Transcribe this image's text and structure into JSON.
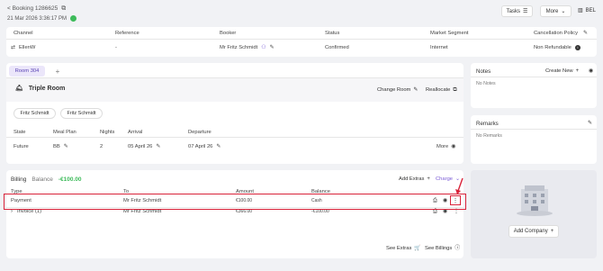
{
  "top": {
    "back_label": "< Booking 1286625",
    "datetime": "21 Mar 2026 3:36:17 PM",
    "tasks_label": "Tasks",
    "more_label": "More",
    "lang_label": "BEL"
  },
  "summary": {
    "headers": [
      "Channel",
      "Reference",
      "Booker",
      "Status",
      "Market Segment",
      "Cancellation Policy"
    ],
    "values": {
      "channel": "EllenW",
      "reference": "-",
      "booker": "Mr Fritz Schmidt",
      "status": "Confirmed",
      "segment": "Internet",
      "policy": "Non Refundable"
    }
  },
  "room": {
    "tab_label": "Room 304",
    "add_tab": "+",
    "room_type": "Triple Room",
    "change_room": "Change Room",
    "reallocate": "Reallocate",
    "guests": [
      "Fritz Schmidt",
      "Fritz Schmidt"
    ],
    "headers": [
      "State",
      "Meal Plan",
      "Nights",
      "Arrival",
      "Departure"
    ],
    "row": {
      "state": "Future",
      "meal_plan": "BB",
      "nights": "2",
      "arrival": "05 April 26",
      "departure": "07 April 26"
    },
    "more_label": "More"
  },
  "notes": {
    "title": "Notes",
    "create_new": "Create New",
    "empty": "No Notes"
  },
  "remarks": {
    "title": "Remarks",
    "empty": "No Remarks"
  },
  "company": {
    "add_label": "Add Company"
  },
  "billing": {
    "title": "Billing",
    "balance_label": "Balance",
    "balance_value": "-€100.00",
    "add_extras": "Add Extras",
    "charge": "Charge",
    "headers": [
      "Type",
      "To",
      "Amount",
      "Balance"
    ],
    "rows": [
      {
        "type": "Payment",
        "to": "Mr Fritz Schmidt",
        "amount": "€100.00",
        "balance": "Cash"
      },
      {
        "type": "Invoice (1)",
        "to": "Mr Fritz Schmidt",
        "amount": "€366.00",
        "balance": "-€100.00"
      }
    ],
    "see_extras": "See Extras",
    "see_billings": "See Billings"
  },
  "colors": {
    "accent": "#7b5cd6",
    "highlight": "#d9233a",
    "status_green": "#3dbb5a"
  }
}
